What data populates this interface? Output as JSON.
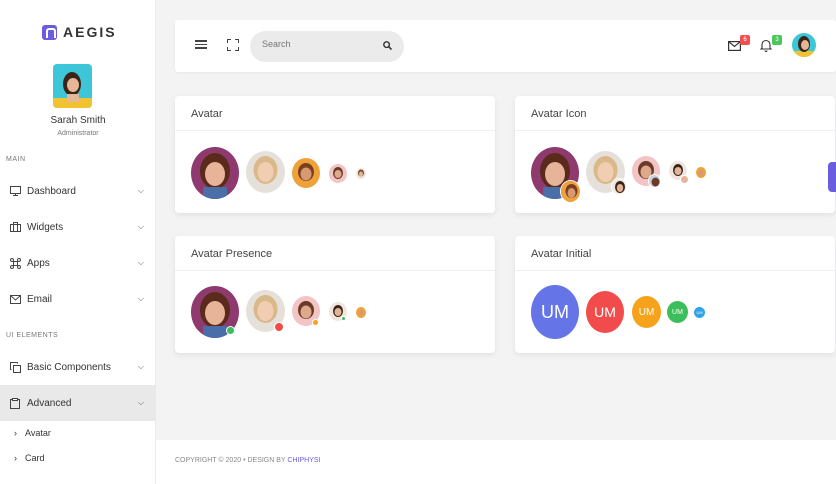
{
  "brand": {
    "name": "AEGIS",
    "accent": "#6b5de0"
  },
  "profile": {
    "name": "Sarah Smith",
    "role": "Administrator"
  },
  "sidebar": {
    "section_main": "MAIN",
    "section_ui": "UI ELEMENTS",
    "items": [
      {
        "label": "Dashboard",
        "icon": "monitor-icon"
      },
      {
        "label": "Widgets",
        "icon": "briefcase-icon"
      },
      {
        "label": "Apps",
        "icon": "command-icon"
      },
      {
        "label": "Email",
        "icon": "mail-icon"
      },
      {
        "label": "Basic Components",
        "icon": "copy-icon"
      },
      {
        "label": "Advanced",
        "icon": "clipboard-icon",
        "active": true
      }
    ],
    "subitems": [
      {
        "label": "Avatar"
      },
      {
        "label": "Card"
      }
    ]
  },
  "header": {
    "search_placeholder": "Search",
    "mail_count": "6",
    "notification_count": "3",
    "mail_badge_color": "#f05050",
    "bell_badge_color": "#4cc75a"
  },
  "cards": {
    "avatar": {
      "title": "Avatar"
    },
    "avatar_icon": {
      "title": "Avatar Icon"
    },
    "avatar_presence": {
      "title": "Avatar Presence"
    },
    "avatar_initial": {
      "title": "Avatar Initial",
      "initials": [
        {
          "text": "UM",
          "color": "#6575e8"
        },
        {
          "text": "UM",
          "color": "#f24b4b"
        },
        {
          "text": "UM",
          "color": "#f7a21b"
        },
        {
          "text": "UM",
          "color": "#3cbf5a"
        },
        {
          "text": "UM",
          "color": "#2fa4e7"
        }
      ]
    }
  },
  "presence_colors": {
    "online": "#3cbf5a",
    "busy": "#f24b4b",
    "away": "#f7a21b"
  },
  "footer": {
    "copyright": "COPYRIGHT © 2020",
    "separator": "•",
    "design_by": "DESIGN BY",
    "designer": "CHIPHYSI"
  }
}
